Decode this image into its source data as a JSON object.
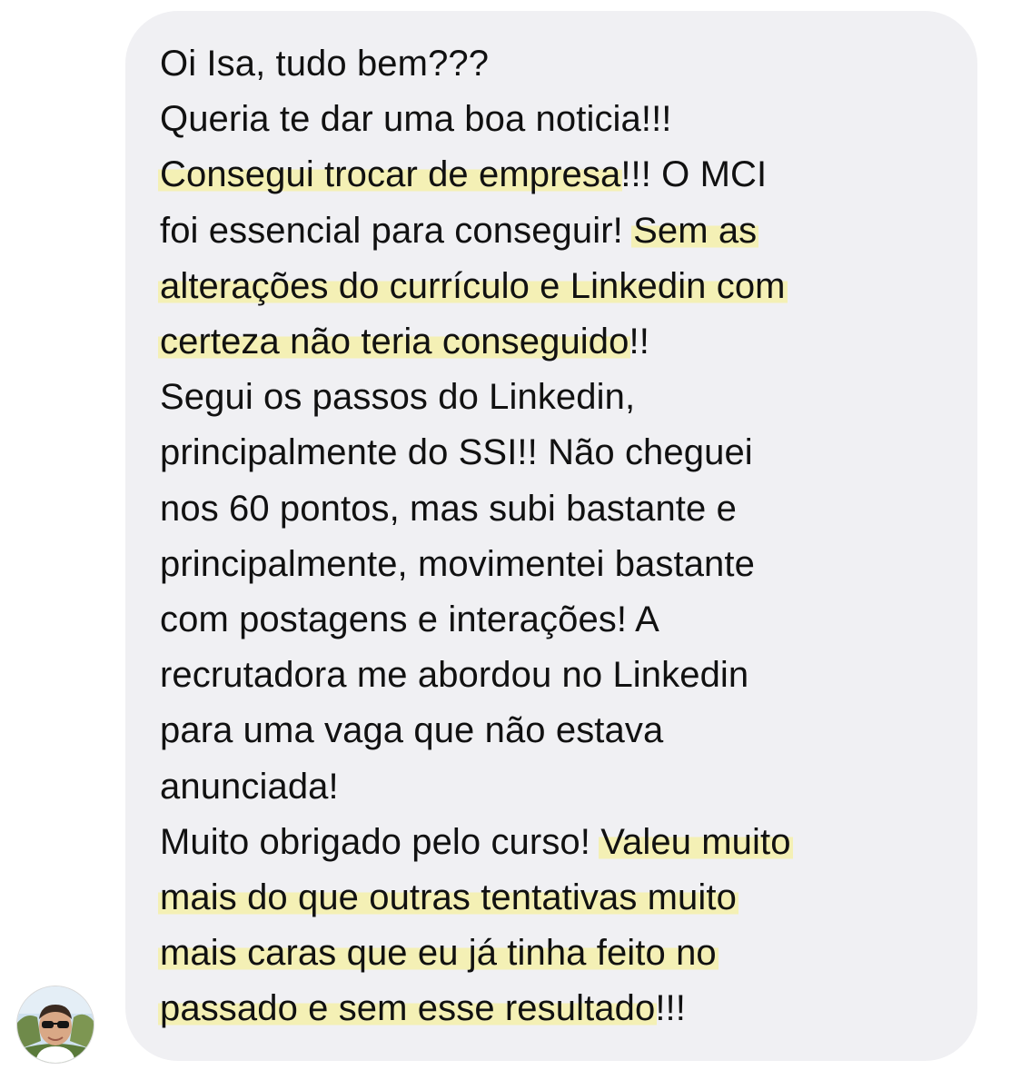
{
  "message": {
    "sender_avatar": "user-avatar-photo",
    "highlight_color": "#f5f0a0",
    "bubble_color": "#f0f0f3",
    "lines": [
      {
        "segments": [
          {
            "text": "Oi Isa, tudo bem???",
            "hl": false
          }
        ]
      },
      {
        "segments": [
          {
            "text": "Queria te dar uma boa noticia!!!",
            "hl": false
          }
        ]
      },
      {
        "segments": [
          {
            "text": "Consegui trocar de empresa",
            "hl": true
          },
          {
            "text": "!!! O MCI",
            "hl": false
          }
        ]
      },
      {
        "segments": [
          {
            "text": "foi essencial para conseguir! ",
            "hl": false
          },
          {
            "text": "Sem as",
            "hl": true
          }
        ]
      },
      {
        "segments": [
          {
            "text": "alterações do currículo e Linkedin com",
            "hl": true
          }
        ]
      },
      {
        "segments": [
          {
            "text": "certeza não teria conseguido",
            "hl": true
          },
          {
            "text": "!!",
            "hl": false
          }
        ]
      },
      {
        "segments": [
          {
            "text": "Segui os passos do Linkedin,",
            "hl": false
          }
        ]
      },
      {
        "segments": [
          {
            "text": "principalmente do SSI!! Não cheguei",
            "hl": false
          }
        ]
      },
      {
        "segments": [
          {
            "text": "nos 60 pontos, mas subi bastante e",
            "hl": false
          }
        ]
      },
      {
        "segments": [
          {
            "text": "principalmente, movimentei bastante",
            "hl": false
          }
        ]
      },
      {
        "segments": [
          {
            "text": "com postagens e interações! A",
            "hl": false
          }
        ]
      },
      {
        "segments": [
          {
            "text": "recrutadora me abordou no Linkedin",
            "hl": false
          }
        ]
      },
      {
        "segments": [
          {
            "text": "para uma vaga que não estava",
            "hl": false
          }
        ]
      },
      {
        "segments": [
          {
            "text": "anunciada!",
            "hl": false
          }
        ]
      },
      {
        "segments": [
          {
            "text": "Muito obrigado pelo curso! ",
            "hl": false
          },
          {
            "text": "Valeu muito",
            "hl": true
          }
        ]
      },
      {
        "segments": [
          {
            "text": "mais do que outras tentativas muito",
            "hl": true
          }
        ]
      },
      {
        "segments": [
          {
            "text": "mais caras que eu já tinha feito no",
            "hl": true
          }
        ]
      },
      {
        "segments": [
          {
            "text": "passado e sem esse resultado",
            "hl": true
          },
          {
            "text": "!!!",
            "hl": false
          }
        ]
      }
    ]
  }
}
